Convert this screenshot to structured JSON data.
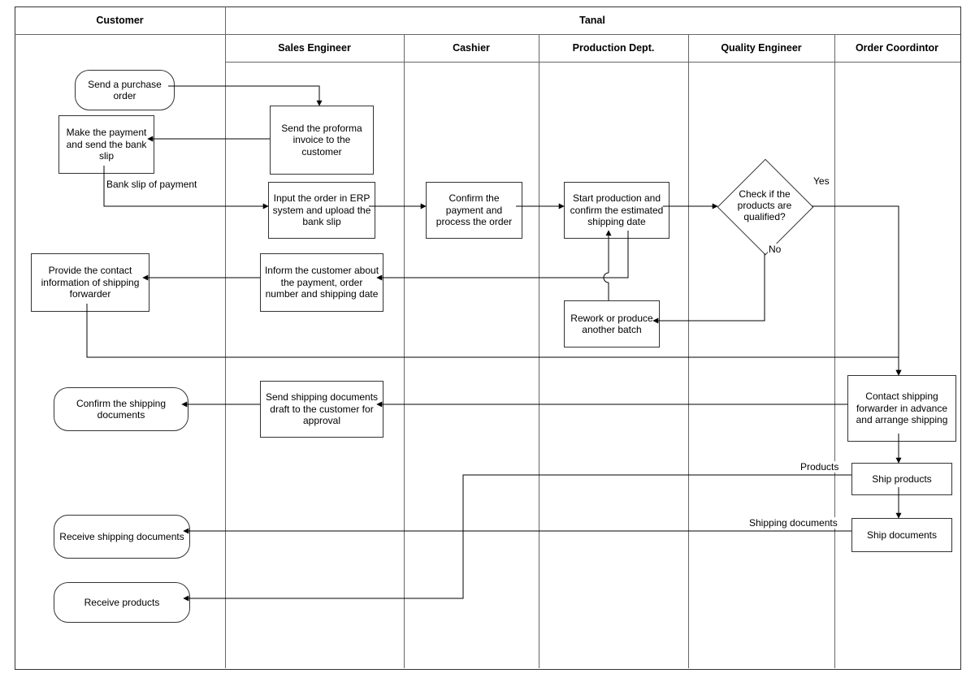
{
  "lanes": {
    "customer": "Customer",
    "tanal": "Tanal",
    "sales_engineer": "Sales Engineer",
    "cashier": "Cashier",
    "production": "Production Dept.",
    "quality": "Quality Engineer",
    "order_coord": "Order Coordintor"
  },
  "nodes": {
    "send_po": "Send a purchase order",
    "make_payment": "Make the payment and send the bank slip",
    "send_proforma": "Send the proforma invoice to the customer",
    "input_erp": "Input the order in ERP system and upload the bank slip",
    "confirm_payment": "Confirm the payment and process the order",
    "start_production": "Start production and confirm the estimated shipping date",
    "check_qualified": "Check if the products are qualified?",
    "inform_customer": "Inform the customer about the payment, order number and shipping date",
    "provide_forwarder": "Provide the contact information of shipping forwarder",
    "rework": "Rework or produce another batch",
    "contact_forwarder": "Contact shipping forwarder in advance and arrange shipping",
    "send_draft_docs": "Send shipping documents draft to the customer for approval",
    "confirm_docs": "Confirm the shipping documents",
    "ship_products": "Ship products",
    "ship_documents": "Ship documents",
    "receive_docs": "Receive shipping documents",
    "receive_products": "Receive products"
  },
  "labels": {
    "bank_slip": "Bank slip of payment",
    "yes": "Yes",
    "no": "No",
    "products": "Products",
    "shipping_docs": "Shipping documents"
  }
}
